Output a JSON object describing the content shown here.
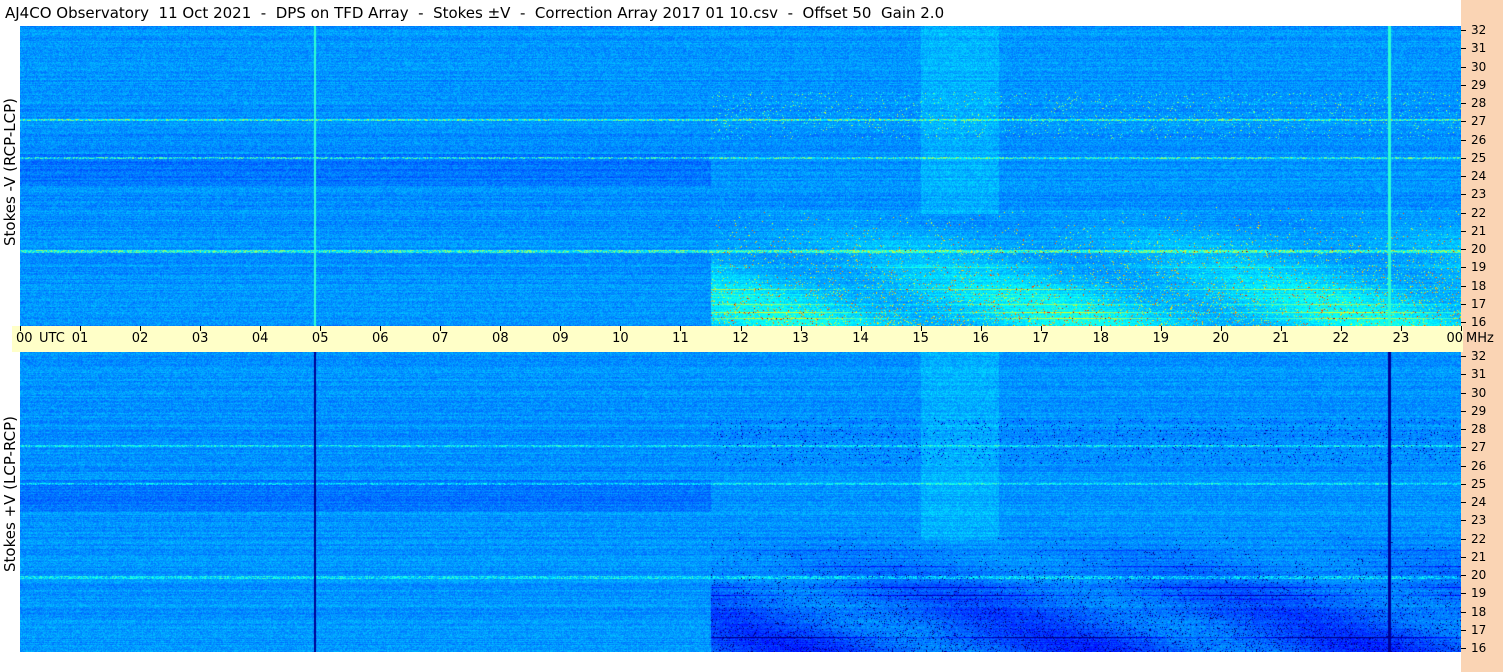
{
  "title": "AJ4CO Observatory  11 Oct 2021  -  DPS on TFD Array  -  Stokes ±V  -  Correction Array 2017 01 10.csv  -  Offset 50  Gain 2.0",
  "panels": {
    "top": {
      "ylabel": "Stokes -V (RCP-LCP)"
    },
    "bottom": {
      "ylabel": "Stokes +V (LCP-RCP)"
    }
  },
  "colors": {
    "time_axis_bg": "#ffffc8",
    "freq_axis_bg": "#fad4b4",
    "background_blue": "#1560d8"
  },
  "chart_data": [
    {
      "type": "heatmap",
      "panel": "top",
      "ylabel": "Stokes -V (RCP-LCP)",
      "x_unit": "UTC",
      "y_unit": "MHz",
      "xlim": [
        0,
        24
      ],
      "ylim": [
        16,
        32
      ],
      "x_ticks": [
        "00",
        "01",
        "02",
        "03",
        "04",
        "05",
        "06",
        "07",
        "08",
        "09",
        "10",
        "11",
        "12",
        "13",
        "14",
        "15",
        "16",
        "17",
        "18",
        "19",
        "20",
        "21",
        "22",
        "23",
        "00"
      ],
      "y_ticks": [
        "16",
        "17",
        "18",
        "19",
        "20",
        "21",
        "22",
        "23",
        "24",
        "25",
        "26",
        "27",
        "28",
        "29",
        "30",
        "31",
        "32"
      ],
      "colormap": "jet",
      "features": [
        {
          "kind": "vertical_line",
          "time": 4.9,
          "color": "light"
        },
        {
          "kind": "vertical_line",
          "time": 22.8,
          "color": "light"
        },
        {
          "kind": "horizontal_band",
          "freq": 20.0
        },
        {
          "kind": "horizontal_band",
          "freq": 25.0
        },
        {
          "kind": "horizontal_band",
          "freq": 27.0
        },
        {
          "kind": "hot_region",
          "time_range": [
            11.5,
            24
          ],
          "freq_range": [
            16,
            22
          ]
        }
      ]
    },
    {
      "type": "heatmap",
      "panel": "bottom",
      "ylabel": "Stokes +V (LCP-RCP)",
      "x_unit": "UTC",
      "y_unit": "MHz",
      "xlim": [
        0,
        24
      ],
      "ylim": [
        16,
        32
      ],
      "x_ticks": [
        "00",
        "01",
        "02",
        "03",
        "04",
        "05",
        "06",
        "07",
        "08",
        "09",
        "10",
        "11",
        "12",
        "13",
        "14",
        "15",
        "16",
        "17",
        "18",
        "19",
        "20",
        "21",
        "22",
        "23",
        "00"
      ],
      "y_ticks": [
        "16",
        "17",
        "18",
        "19",
        "20",
        "21",
        "22",
        "23",
        "24",
        "25",
        "26",
        "27",
        "28",
        "29",
        "30",
        "31",
        "32"
      ],
      "colormap": "jet",
      "features": [
        {
          "kind": "vertical_line",
          "time": 4.9,
          "color": "dark"
        },
        {
          "kind": "vertical_line",
          "time": 22.8,
          "color": "dark"
        },
        {
          "kind": "horizontal_band",
          "freq": 20.0
        },
        {
          "kind": "horizontal_band",
          "freq": 25.0
        },
        {
          "kind": "horizontal_band",
          "freq": 27.0
        },
        {
          "kind": "dark_region",
          "time_range": [
            11.5,
            24
          ],
          "freq_range": [
            16,
            19
          ]
        }
      ]
    }
  ],
  "axis": {
    "utc_label": "UTC",
    "mhz_label": "MHz"
  }
}
